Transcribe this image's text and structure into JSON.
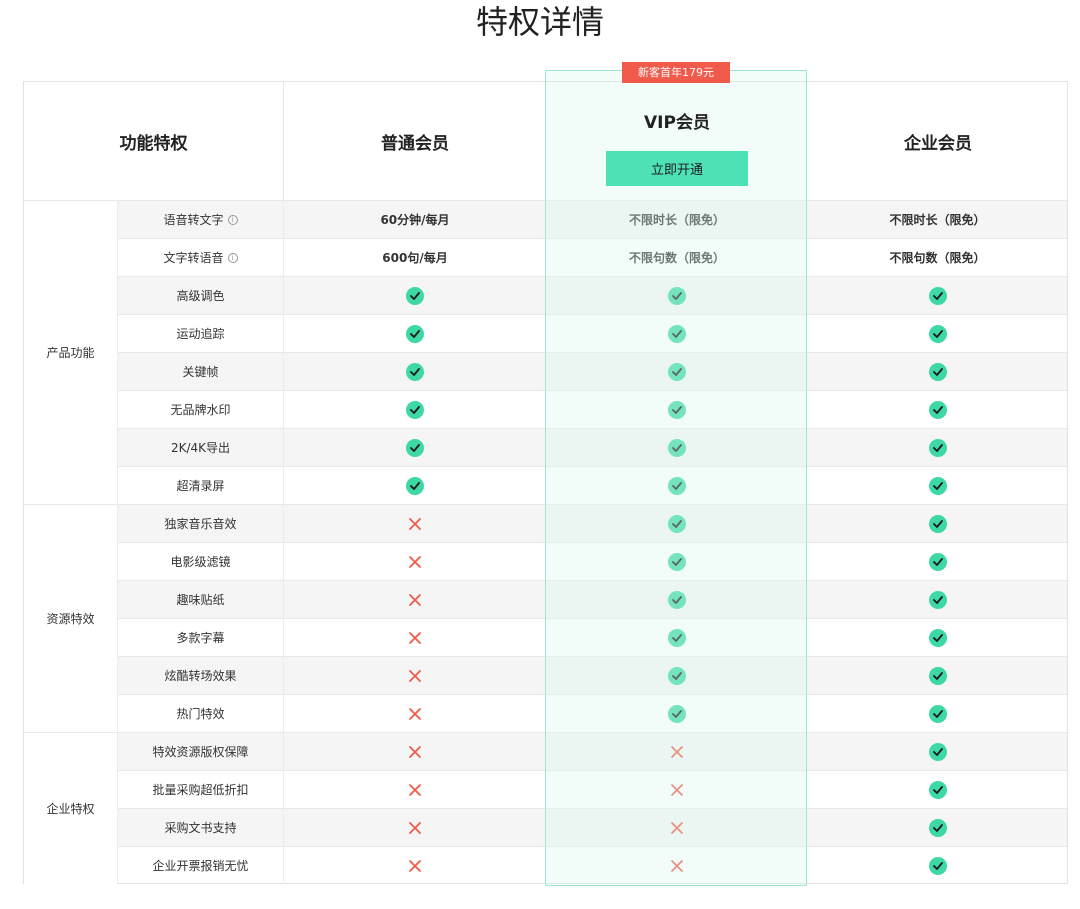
{
  "page_title": "特权详情",
  "badge": "新客首年179元",
  "columns": {
    "feature": "功能特权",
    "basic": "普通会员",
    "vip": "VIP会员",
    "enterprise": "企业会员"
  },
  "open_button": "立即开通",
  "colors": {
    "accent": "#4fe1b6",
    "check": "#3ed8a6",
    "cross": "#ef5a4b",
    "badge": "#ef5a4b"
  },
  "groups": [
    {
      "name": "产品功能",
      "rows": 8
    },
    {
      "name": "资源特效",
      "rows": 6
    },
    {
      "name": "企业特权",
      "rows": 4
    }
  ],
  "rows": [
    {
      "feature": "语音转文字",
      "info": true,
      "basic": "60分钟/每月",
      "vip": "不限时长（限免）",
      "enterprise": "不限时长（限免）"
    },
    {
      "feature": "文字转语音",
      "info": true,
      "basic": "600句/每月",
      "vip": "不限句数（限免）",
      "enterprise": "不限句数（限免）"
    },
    {
      "feature": "高级调色",
      "basic": "check",
      "vip": "check",
      "enterprise": "check"
    },
    {
      "feature": "运动追踪",
      "basic": "check",
      "vip": "check",
      "enterprise": "check"
    },
    {
      "feature": "关键帧",
      "basic": "check",
      "vip": "check",
      "enterprise": "check"
    },
    {
      "feature": "无品牌水印",
      "basic": "check",
      "vip": "check",
      "enterprise": "check"
    },
    {
      "feature": "2K/4K导出",
      "basic": "check",
      "vip": "check",
      "enterprise": "check"
    },
    {
      "feature": "超清录屏",
      "basic": "check",
      "vip": "check",
      "enterprise": "check"
    },
    {
      "feature": "独家音乐音效",
      "basic": "cross",
      "vip": "check",
      "enterprise": "check"
    },
    {
      "feature": "电影级滤镜",
      "basic": "cross",
      "vip": "check",
      "enterprise": "check"
    },
    {
      "feature": "趣味贴纸",
      "basic": "cross",
      "vip": "check",
      "enterprise": "check"
    },
    {
      "feature": "多款字幕",
      "basic": "cross",
      "vip": "check",
      "enterprise": "check"
    },
    {
      "feature": "炫酷转场效果",
      "basic": "cross",
      "vip": "check",
      "enterprise": "check"
    },
    {
      "feature": "热门特效",
      "basic": "cross",
      "vip": "check",
      "enterprise": "check"
    },
    {
      "feature": "特效资源版权保障",
      "basic": "cross",
      "vip": "cross",
      "enterprise": "check"
    },
    {
      "feature": "批量采购超低折扣",
      "basic": "cross",
      "vip": "cross",
      "enterprise": "check"
    },
    {
      "feature": "采购文书支持",
      "basic": "cross",
      "vip": "cross",
      "enterprise": "check"
    },
    {
      "feature": "企业开票报销无忧",
      "basic": "cross",
      "vip": "cross",
      "enterprise": "check"
    }
  ]
}
